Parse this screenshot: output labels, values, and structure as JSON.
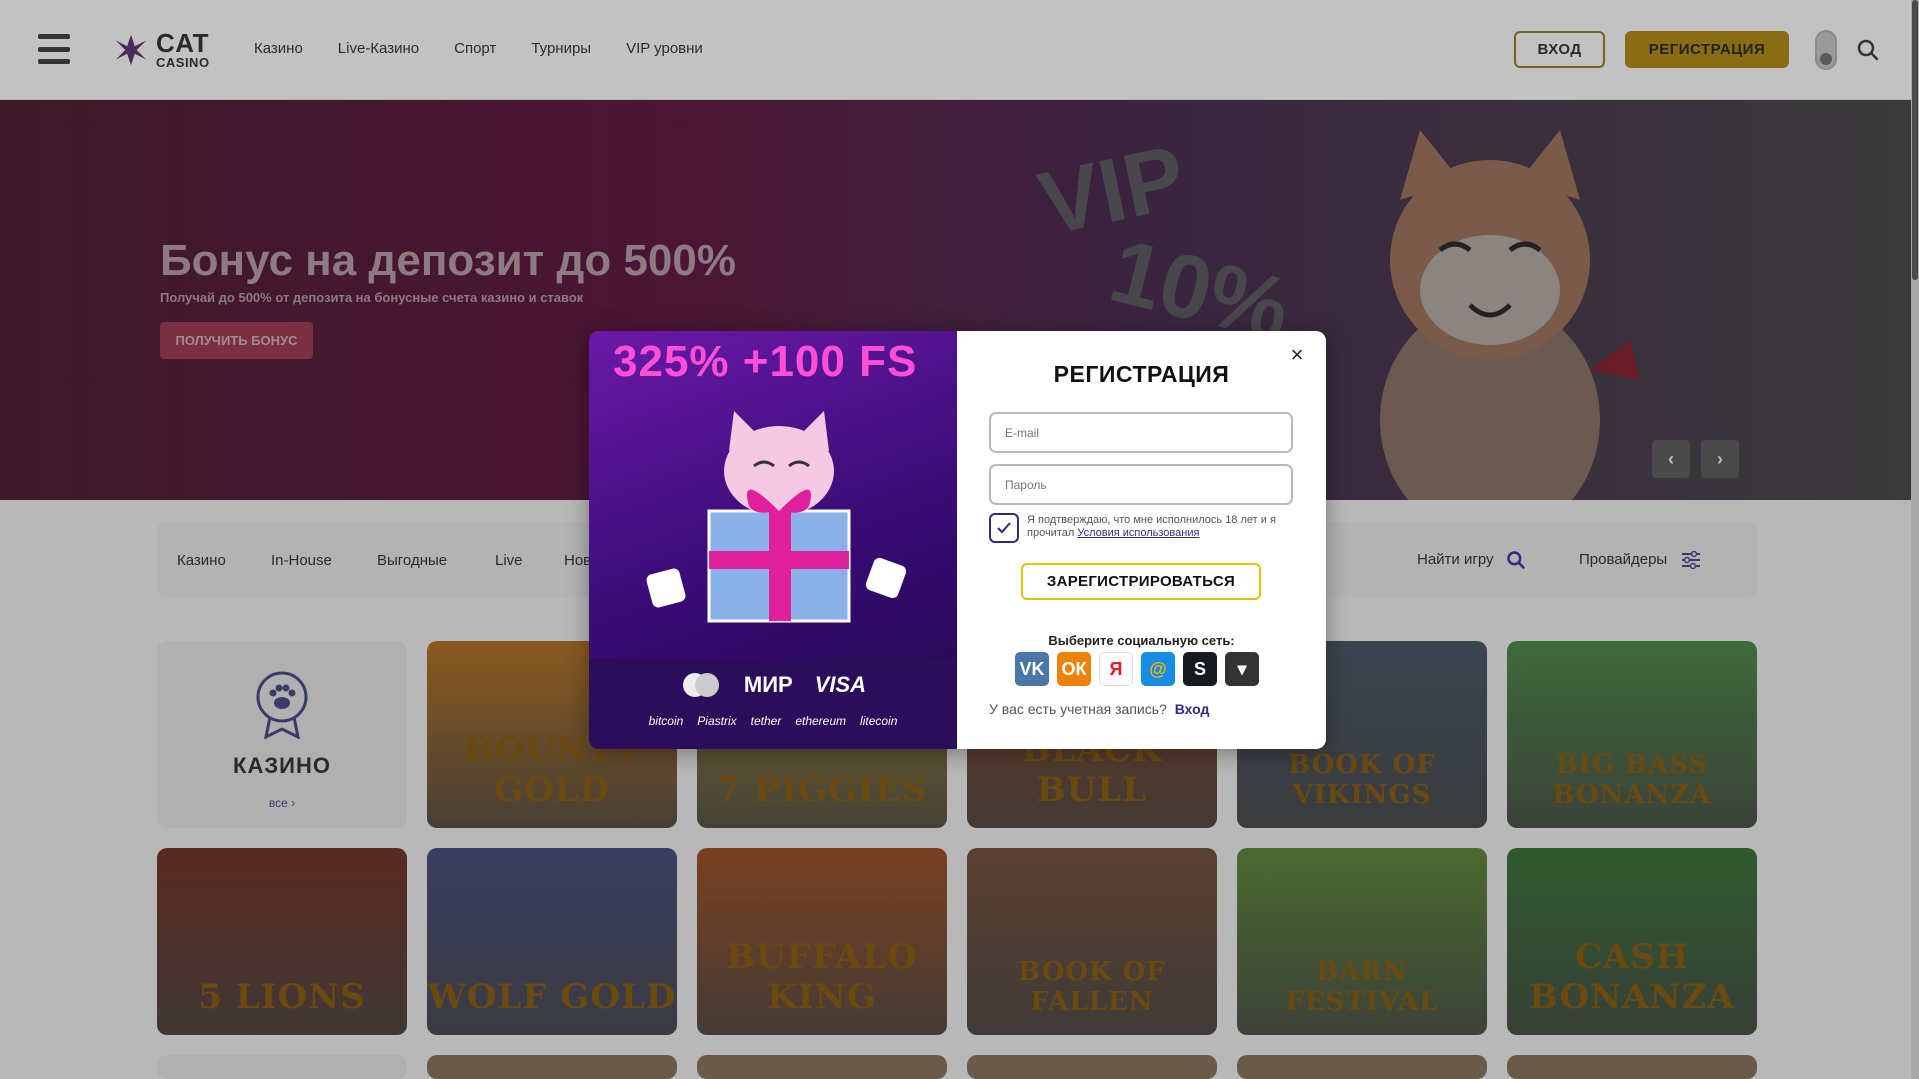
{
  "header": {
    "logo_title": "CAT",
    "logo_sub": "CASINO",
    "nav": [
      "Казино",
      "Live-Казино",
      "Спорт",
      "Турниры",
      "VIP уровни"
    ],
    "login_label": "ВХОД",
    "register_label": "РЕГИСТРАЦИЯ"
  },
  "hero": {
    "title": "Бонус на депозит до 500%",
    "subtitle": "Получай до 500% от депозита на бонусные счета казино и ставок",
    "button": "ПОЛУЧИТЬ БОНУС",
    "art_text_1": "VIP",
    "art_text_2": "10%",
    "prev": "‹",
    "next": "›"
  },
  "categories": {
    "tabs": [
      "Казино",
      "In-House",
      "Выгодные",
      "Live",
      "Нов"
    ],
    "find_label": "Найти игру",
    "providers_label": "Провайдеры"
  },
  "casino_card": {
    "title": "КАЗИНО",
    "all_label": "все ›"
  },
  "games": [
    {
      "name": "BOUNTY GOLD",
      "bg": "#8a5a1e"
    },
    {
      "name": "7 PIGGIES",
      "bg": "#7a6a2c"
    },
    {
      "name": "BLACK BULL",
      "bg": "#6a3a20"
    },
    {
      "name": "BOOK OF VIKINGS",
      "bg": "#3b4550"
    },
    {
      "name": "BIG BASS BONANZA",
      "bg": "#3e6a3a"
    },
    {
      "name": "5 LIONS",
      "bg": "#5a2a20"
    },
    {
      "name": "WOLF GOLD",
      "bg": "#3a3e60"
    },
    {
      "name": "BUFFALO KING",
      "bg": "#7a4020"
    },
    {
      "name": "BOOK OF FALLEN",
      "bg": "#5a4030"
    },
    {
      "name": "BARN FESTIVAL",
      "bg": "#4a6a30"
    },
    {
      "name": "CASH BONANZA",
      "bg": "#2e5a2e"
    }
  ],
  "modal": {
    "promo": "325% +100 FS",
    "pay_logos": [
      "mastercard",
      "МИР",
      "VISA"
    ],
    "crypto": [
      "bitcoin",
      "Piastrix",
      "tether",
      "ethereum",
      "litecoin"
    ],
    "title": "РЕГИСТРАЦИЯ",
    "close": "×",
    "email_placeholder": "E-mail",
    "password_placeholder": "Пароль",
    "confirm_text": "Я подтверждаю, что мне исполнилось 18 лет и я прочитал",
    "terms_link": "Условия использования",
    "submit": "ЗАРЕГИСТРИРОВАТЬСЯ",
    "social_title": "Выберите социальную сеть:",
    "socials": [
      {
        "name": "vk",
        "label": "VK",
        "color": "#4a76a8"
      },
      {
        "name": "odnoklassniki",
        "label": "ОК",
        "color": "#ee8208"
      },
      {
        "name": "yandex",
        "label": "Я",
        "color": "#ffffff"
      },
      {
        "name": "mailru",
        "label": "@",
        "color": "#168de2"
      },
      {
        "name": "steam",
        "label": "S",
        "color": "#171a21"
      },
      {
        "name": "more",
        "label": "▾",
        "color": "#333333"
      }
    ],
    "have_account": "У вас есть учетная запись?",
    "login_link": "Вход"
  },
  "colors": {
    "accent": "#e6c200",
    "brand_purple": "#2d2d82",
    "promo_pink": "#ff4fd8"
  }
}
